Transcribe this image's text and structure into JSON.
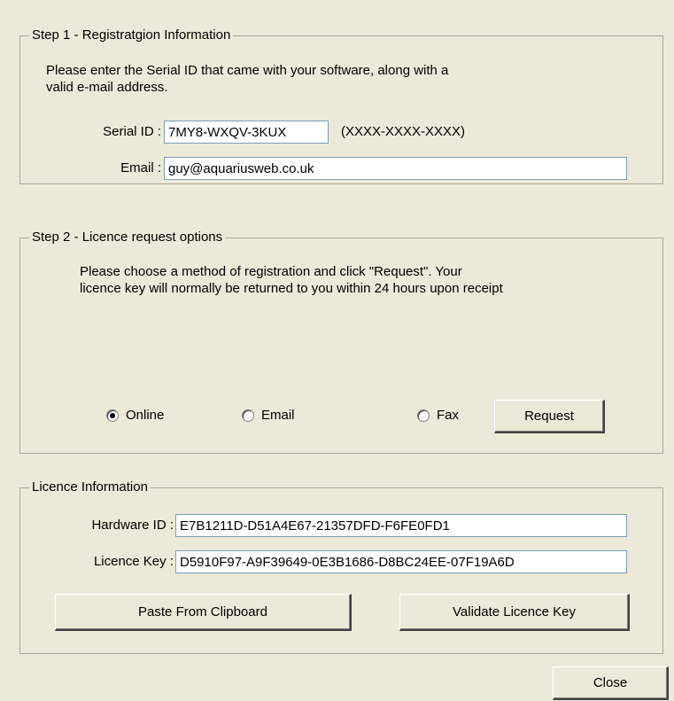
{
  "step1": {
    "title": "Step 1 - Registratgion Information",
    "instructions_line1": "Please enter the Serial ID that came with your software, along with a",
    "instructions_line2": "valid e-mail address.",
    "serial_label": "Serial ID :",
    "serial_value": "7MY8-WXQV-3KUX",
    "serial_format": "(XXXX-XXXX-XXXX)",
    "email_label": "Email :",
    "email_value": "guy@aquariusweb.co.uk"
  },
  "step2": {
    "title": "Step 2 - Licence request options",
    "instructions_line1": "Please choose a method of registration and click \"Request\". Your",
    "instructions_line2": "licence key will normally be returned to you within 24 hours upon receipt",
    "options": [
      {
        "label": "Online",
        "checked": true
      },
      {
        "label": "Email",
        "checked": false
      },
      {
        "label": "Fax",
        "checked": false
      }
    ],
    "request_button": "Request"
  },
  "licence": {
    "title": "Licence Information",
    "hardware_label": "Hardware ID :",
    "hardware_value": "E7B1211D-D51A4E67-21357DFD-F6FE0FD1",
    "key_label": "Licence Key :",
    "key_value": "D5910F97-A9F39649-0E3B1686-D8BC24EE-07F19A6D",
    "paste_button": "Paste From Clipboard",
    "validate_button": "Validate Licence Key"
  },
  "close_button": "Close"
}
